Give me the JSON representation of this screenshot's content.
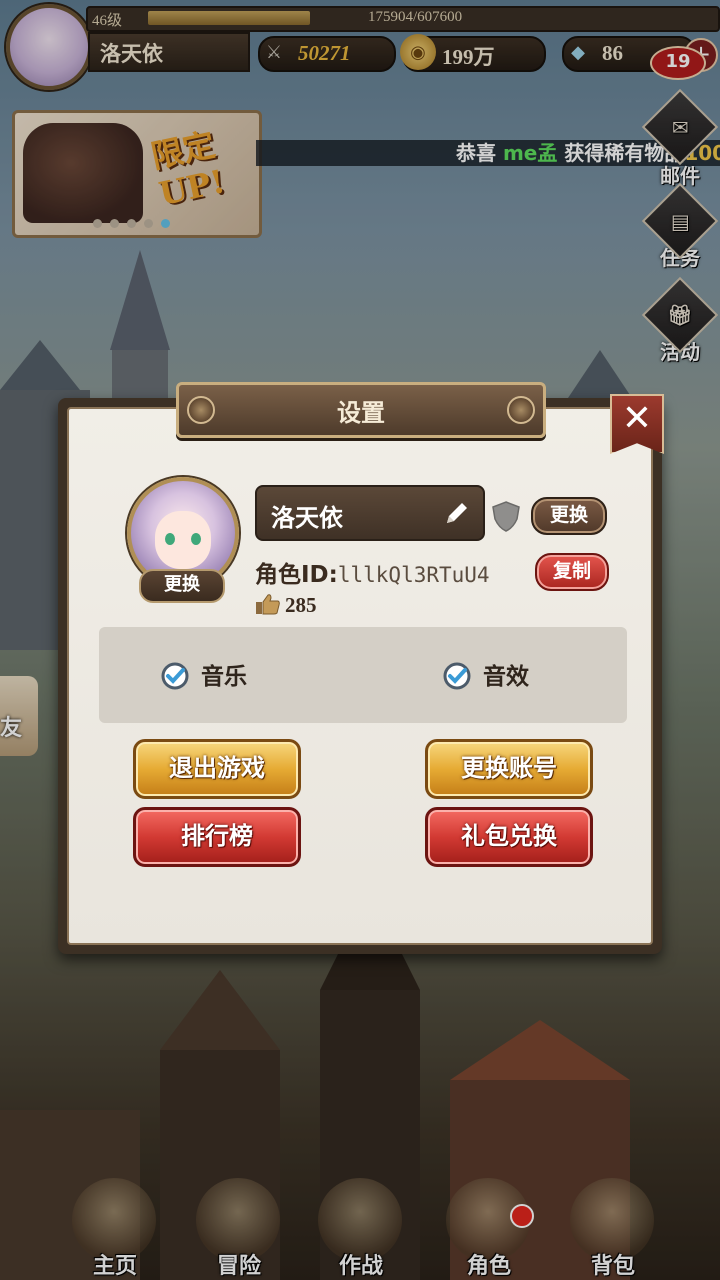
{
  "player": {
    "level": "46级",
    "exp": "175904/607600",
    "exp_fraction": 0.29,
    "name": "洛天依"
  },
  "currencies": {
    "power": "50271",
    "gold": "199万",
    "gems": "86",
    "add": "+"
  },
  "banner": {
    "text_line1": "限定",
    "text_line2": "UP!"
  },
  "marquee": {
    "prefix": "恭喜",
    "player": "me孟",
    "middle": "获得稀有物品",
    "tail": "100"
  },
  "side": {
    "mail_badge": "19",
    "mail_label": "邮件",
    "task_label": "任务",
    "event_label": "活动"
  },
  "left_edge": {
    "label": "友"
  },
  "dialog": {
    "title": "设置",
    "close": "✕",
    "avatar_change": "更换",
    "name_value": "洛天依",
    "change_label": "更换",
    "role_id_label": "角色ID:",
    "role_id_value": "lllkQl3RTuU4",
    "copy_label": "复制",
    "likes": "285",
    "music_label": "音乐",
    "sfx_label": "音效",
    "exit_game": "退出游戏",
    "switch_account": "更换账号",
    "leaderboard": "排行榜",
    "gift_redeem": "礼包兑换"
  },
  "bottom_nav": [
    {
      "label": "主页"
    },
    {
      "label": "冒险"
    },
    {
      "label": "作战"
    },
    {
      "label": "角色"
    },
    {
      "label": "背包"
    }
  ],
  "colors": {
    "accent_gold": "#e6ab34",
    "accent_red": "#d23a33",
    "panel_bg": "#f1eee7",
    "wood": "#4e3b2b"
  }
}
